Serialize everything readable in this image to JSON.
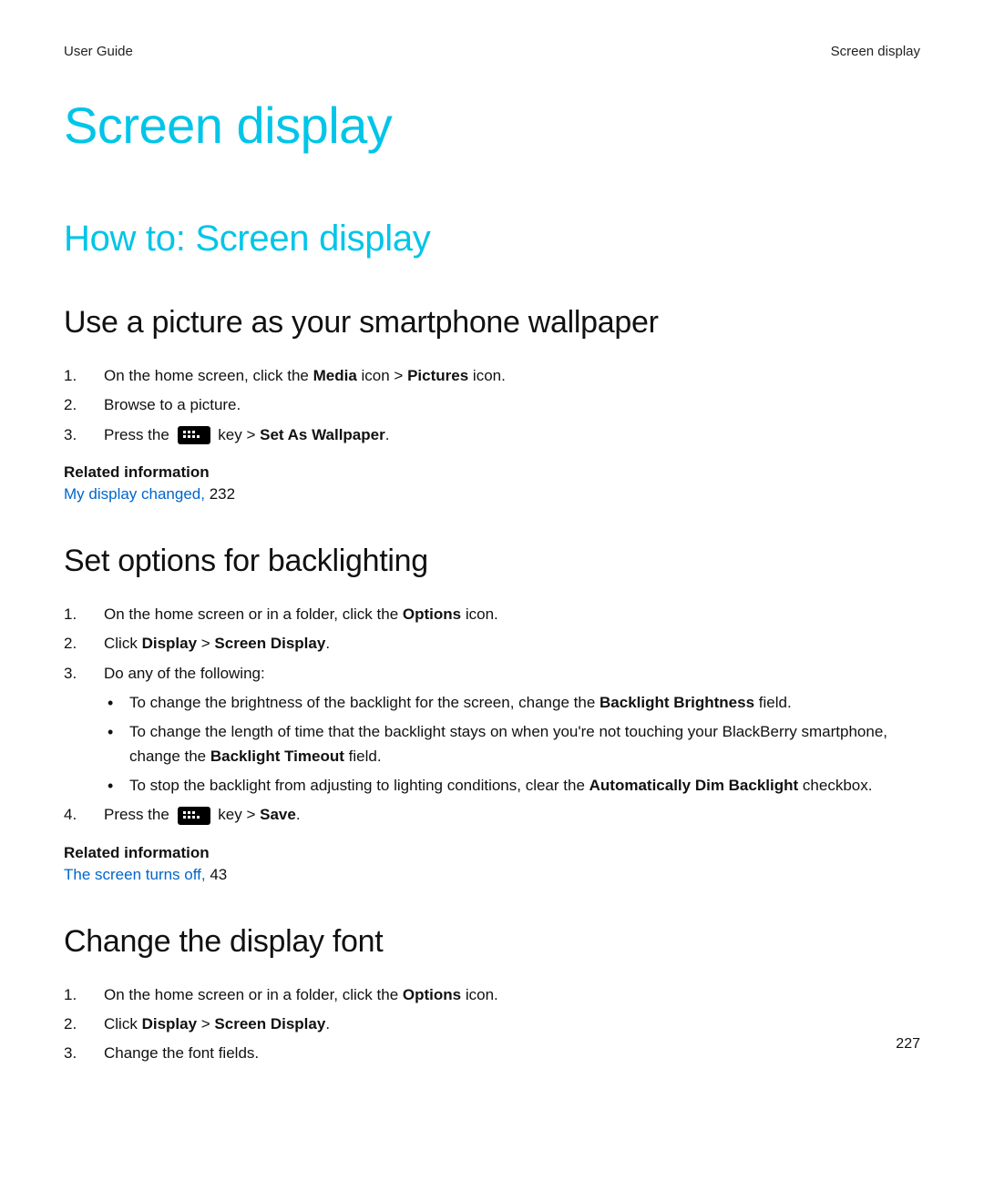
{
  "header": {
    "left": "User Guide",
    "right": "Screen display"
  },
  "title": "Screen display",
  "subtitle": "How to: Screen display",
  "sections": [
    {
      "heading": "Use a picture as your smartphone wallpaper",
      "steps": [
        {
          "pre": "On the home screen, click the ",
          "b1": "Media",
          "mid": " icon > ",
          "b2": "Pictures",
          "post": " icon."
        },
        {
          "plain": "Browse to a picture."
        },
        {
          "pre": "Press the ",
          "icon": true,
          "mid": " key > ",
          "b1": "Set As Wallpaper",
          "post": "."
        }
      ],
      "related": {
        "label": "Related information",
        "link_text": "My display changed,",
        "page": "232"
      }
    },
    {
      "heading": "Set options for backlighting",
      "steps": [
        {
          "pre": "On the home screen or in a folder, click the ",
          "b1": "Options",
          "post": " icon."
        },
        {
          "pre": "Click ",
          "b1": "Display",
          "mid": " > ",
          "b2": "Screen Display",
          "post": "."
        },
        {
          "plain": "Do any of the following:",
          "bullets": [
            {
              "pre": "To change the brightness of the backlight for the screen, change the ",
              "b1": "Backlight Brightness",
              "post": " field."
            },
            {
              "pre": "To change the length of time that the backlight stays on when you're not touching your BlackBerry smartphone, change the ",
              "b1": "Backlight Timeout",
              "post": " field."
            },
            {
              "pre": "To stop the backlight from adjusting to lighting conditions, clear the ",
              "b1": "Automatically Dim Backlight",
              "post": " checkbox."
            }
          ]
        },
        {
          "pre": "Press the ",
          "icon": true,
          "mid": " key > ",
          "b1": "Save",
          "post": "."
        }
      ],
      "related": {
        "label": "Related information",
        "link_text": "The screen turns off,",
        "page": "43"
      }
    },
    {
      "heading": "Change the display font",
      "steps": [
        {
          "pre": "On the home screen or in a folder, click the ",
          "b1": "Options",
          "post": " icon."
        },
        {
          "pre": "Click ",
          "b1": "Display",
          "mid": " > ",
          "b2": "Screen Display",
          "post": "."
        },
        {
          "plain": "Change the font fields."
        }
      ]
    }
  ],
  "page_number": "227"
}
